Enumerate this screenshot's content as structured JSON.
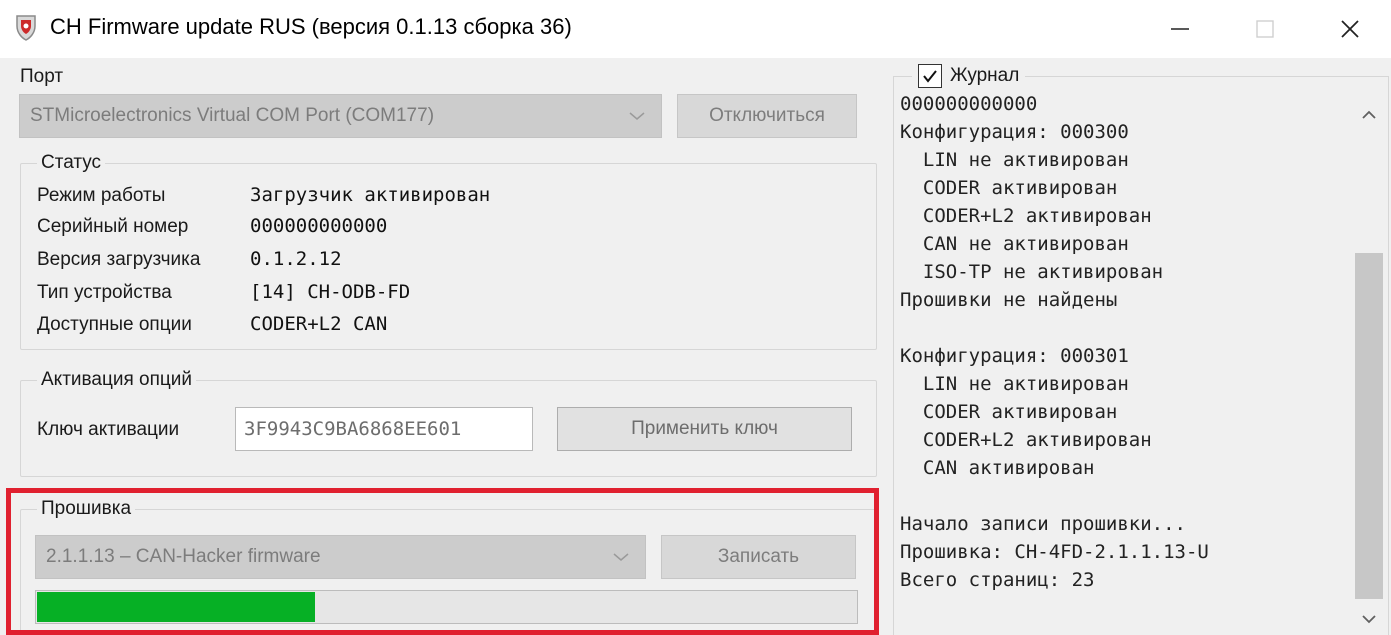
{
  "window": {
    "title": "CH Firmware update RUS (версия 0.1.13 сборка 36)",
    "app_icon": "shield-app-icon",
    "controls": [
      "minimize-icon",
      "maximize-icon",
      "close-icon"
    ]
  },
  "port": {
    "label": "Порт",
    "selected": "STMicroelectronics Virtual COM Port (COM177)",
    "disconnect_label": "Отключиться"
  },
  "status": {
    "legend": "Статус",
    "rows": [
      {
        "label": "Режим работы",
        "value": "Загрузчик активирован"
      },
      {
        "label": "Серийный номер",
        "value": "000000000000"
      },
      {
        "label": "Версия загрузчика",
        "value": "0.1.2.12"
      },
      {
        "label": "Тип устройства",
        "value": "[14] CH-ODB-FD"
      },
      {
        "label": "Доступные опции",
        "value": "CODER+L2  CAN"
      }
    ]
  },
  "activation": {
    "legend": "Активация опций",
    "key_label": "Ключ активации",
    "key_value": "3F9943C9BA6868EE601",
    "apply_label": "Применить ключ"
  },
  "firmware": {
    "legend": "Прошивка",
    "selected": "2.1.1.13 – CAN-Hacker firmware",
    "write_label": "Записать",
    "progress_percent": 34
  },
  "log": {
    "legend": "Журнал",
    "checked": true,
    "lines": [
      "000000000000",
      "Конфигурация: 000300",
      "  LIN не активирован",
      "  CODER активирован",
      "  CODER+L2 активирован",
      "  CAN не активирован",
      "  ISO-TP не активирован",
      "Прошивки не найдены",
      "",
      "Конфигурация: 000301",
      "  LIN не активирован",
      "  CODER активирован",
      "  CODER+L2 активирован",
      "  CAN активирован",
      "",
      "Начало записи прошивки...",
      "Прошивка: CH-4FD-2.1.1.13-U",
      "Всего страниц: 23"
    ]
  },
  "colors": {
    "progress": "#06b025",
    "highlight": "#e0202f",
    "window_bg": "#f0f0f0"
  }
}
